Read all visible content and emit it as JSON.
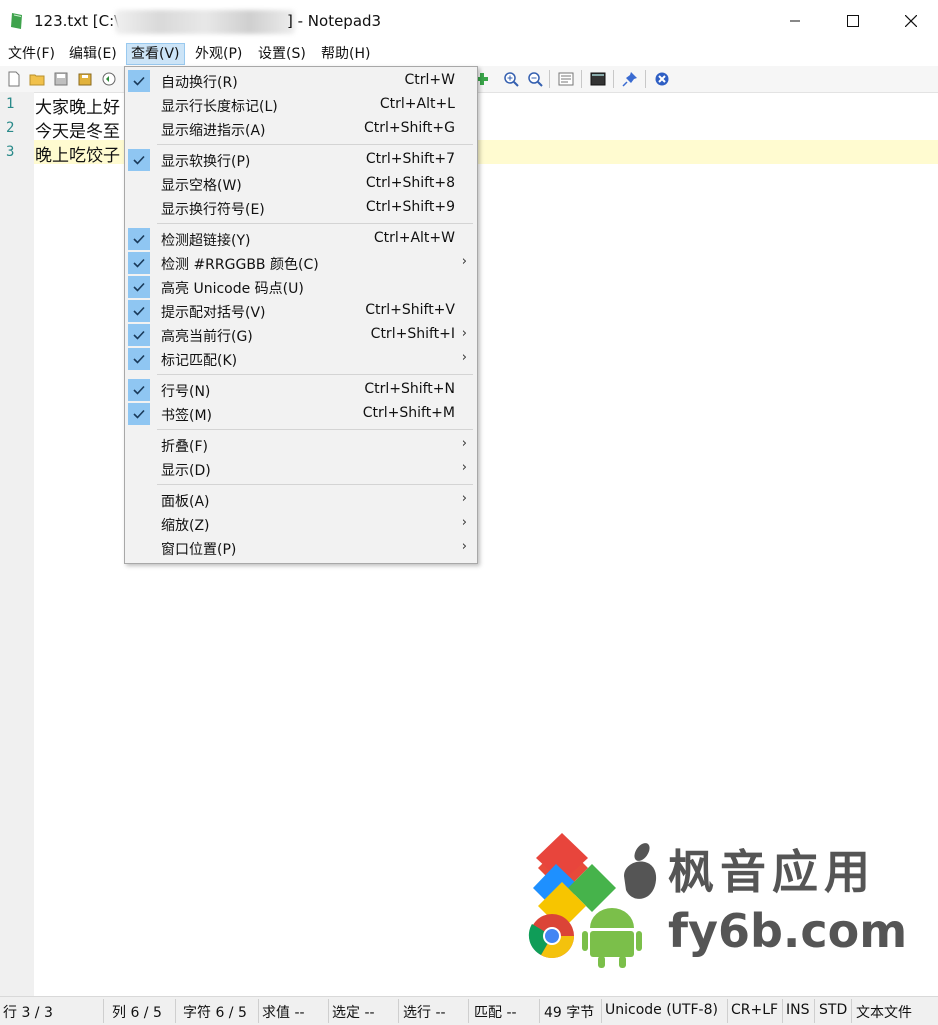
{
  "window": {
    "title_prefix": "123.txt [C:\\",
    "title_suffix": "] - Notepad3"
  },
  "menubar": {
    "items": [
      "文件(F)",
      "编辑(E)",
      "查看(V)",
      "外观(P)",
      "设置(S)",
      "帮助(H)"
    ],
    "active": "查看(V)"
  },
  "editor": {
    "lines": [
      {
        "num": "1",
        "text": "大家晚上好"
      },
      {
        "num": "2",
        "text": "今天是冬至"
      },
      {
        "num": "3",
        "text": "晚上吃饺子"
      }
    ]
  },
  "view_menu": {
    "items": [
      {
        "label": "自动换行(R)",
        "shortcut": "Ctrl+W",
        "checked": true
      },
      {
        "label": "显示行长度标记(L)",
        "shortcut": "Ctrl+Alt+L",
        "checked": false
      },
      {
        "label": "显示缩进指示(A)",
        "shortcut": "Ctrl+Shift+G",
        "checked": false
      },
      {
        "label": "显示软换行(P)",
        "shortcut": "Ctrl+Shift+7",
        "checked": true
      },
      {
        "label": "显示空格(W)",
        "shortcut": "Ctrl+Shift+8",
        "checked": false
      },
      {
        "label": "显示换行符号(E)",
        "shortcut": "Ctrl+Shift+9",
        "checked": false
      },
      {
        "label": "检测超链接(Y)",
        "shortcut": "Ctrl+Alt+W",
        "checked": true
      },
      {
        "label": "检测 #RRGGBB 颜色(C)",
        "shortcut": "",
        "checked": true,
        "submenu": true
      },
      {
        "label": "高亮 Unicode 码点(U)",
        "shortcut": "",
        "checked": true
      },
      {
        "label": "提示配对括号(V)",
        "shortcut": "Ctrl+Shift+V",
        "checked": true
      },
      {
        "label": "高亮当前行(G)",
        "shortcut": "Ctrl+Shift+I",
        "checked": true,
        "submenu": true
      },
      {
        "label": "标记匹配(K)",
        "shortcut": "",
        "checked": true,
        "submenu": true
      },
      {
        "label": "行号(N)",
        "shortcut": "Ctrl+Shift+N",
        "checked": true
      },
      {
        "label": "书签(M)",
        "shortcut": "Ctrl+Shift+M",
        "checked": true
      },
      {
        "label": "折叠(F)",
        "shortcut": "",
        "checked": false,
        "submenu": true
      },
      {
        "label": "显示(D)",
        "shortcut": "",
        "checked": false,
        "submenu": true
      },
      {
        "label": "面板(A)",
        "shortcut": "",
        "checked": false,
        "submenu": true
      },
      {
        "label": "缩放(Z)",
        "shortcut": "",
        "checked": false,
        "submenu": true
      },
      {
        "label": "窗口位置(P)",
        "shortcut": "",
        "checked": false,
        "submenu": true
      }
    ]
  },
  "watermark": {
    "cn": "枫音应用",
    "en": "fy6b.com"
  },
  "statusbar": {
    "cells": [
      "行 3 / 3",
      "列 6 / 5",
      "字符 6 / 5",
      "求值 --",
      "选定 --",
      "选行 --",
      "匹配 --",
      "49 字节",
      "Unicode (UTF-8)",
      "CR+LF",
      "INS",
      "STD",
      "文本文件"
    ]
  },
  "colors": {
    "check_bg": "#8fc6f2",
    "current_line": "#fffbd0",
    "line_number": "#2a8a8a"
  }
}
